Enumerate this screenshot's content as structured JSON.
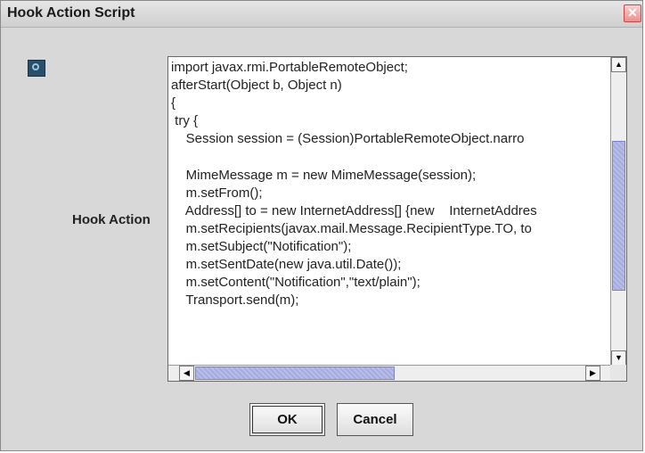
{
  "window": {
    "title": "Hook Action Script",
    "close_glyph": "✕"
  },
  "form": {
    "label": "Hook Action"
  },
  "editor": {
    "code_lines": [
      "import javax.rmi.PortableRemoteObject;",
      "afterStart(Object b, Object n)",
      "{",
      " try {",
      "    Session session = (Session)PortableRemoteObject.narro",
      "",
      "    MimeMessage m = new MimeMessage(session);",
      "    m.setFrom();",
      "    Address[] to = new InternetAddress[] {new    InternetAddres",
      "    m.setRecipients(javax.mail.Message.RecipientType.TO, to",
      "    m.setSubject(\"Notification\");",
      "    m.setSentDate(new java.util.Date());",
      "    m.setContent(\"Notification\",\"text/plain\");",
      "    Transport.send(m);"
    ]
  },
  "buttons": {
    "ok": "OK",
    "cancel": "Cancel"
  },
  "icons": {
    "app": "hook-script-icon",
    "close": "close-icon"
  }
}
